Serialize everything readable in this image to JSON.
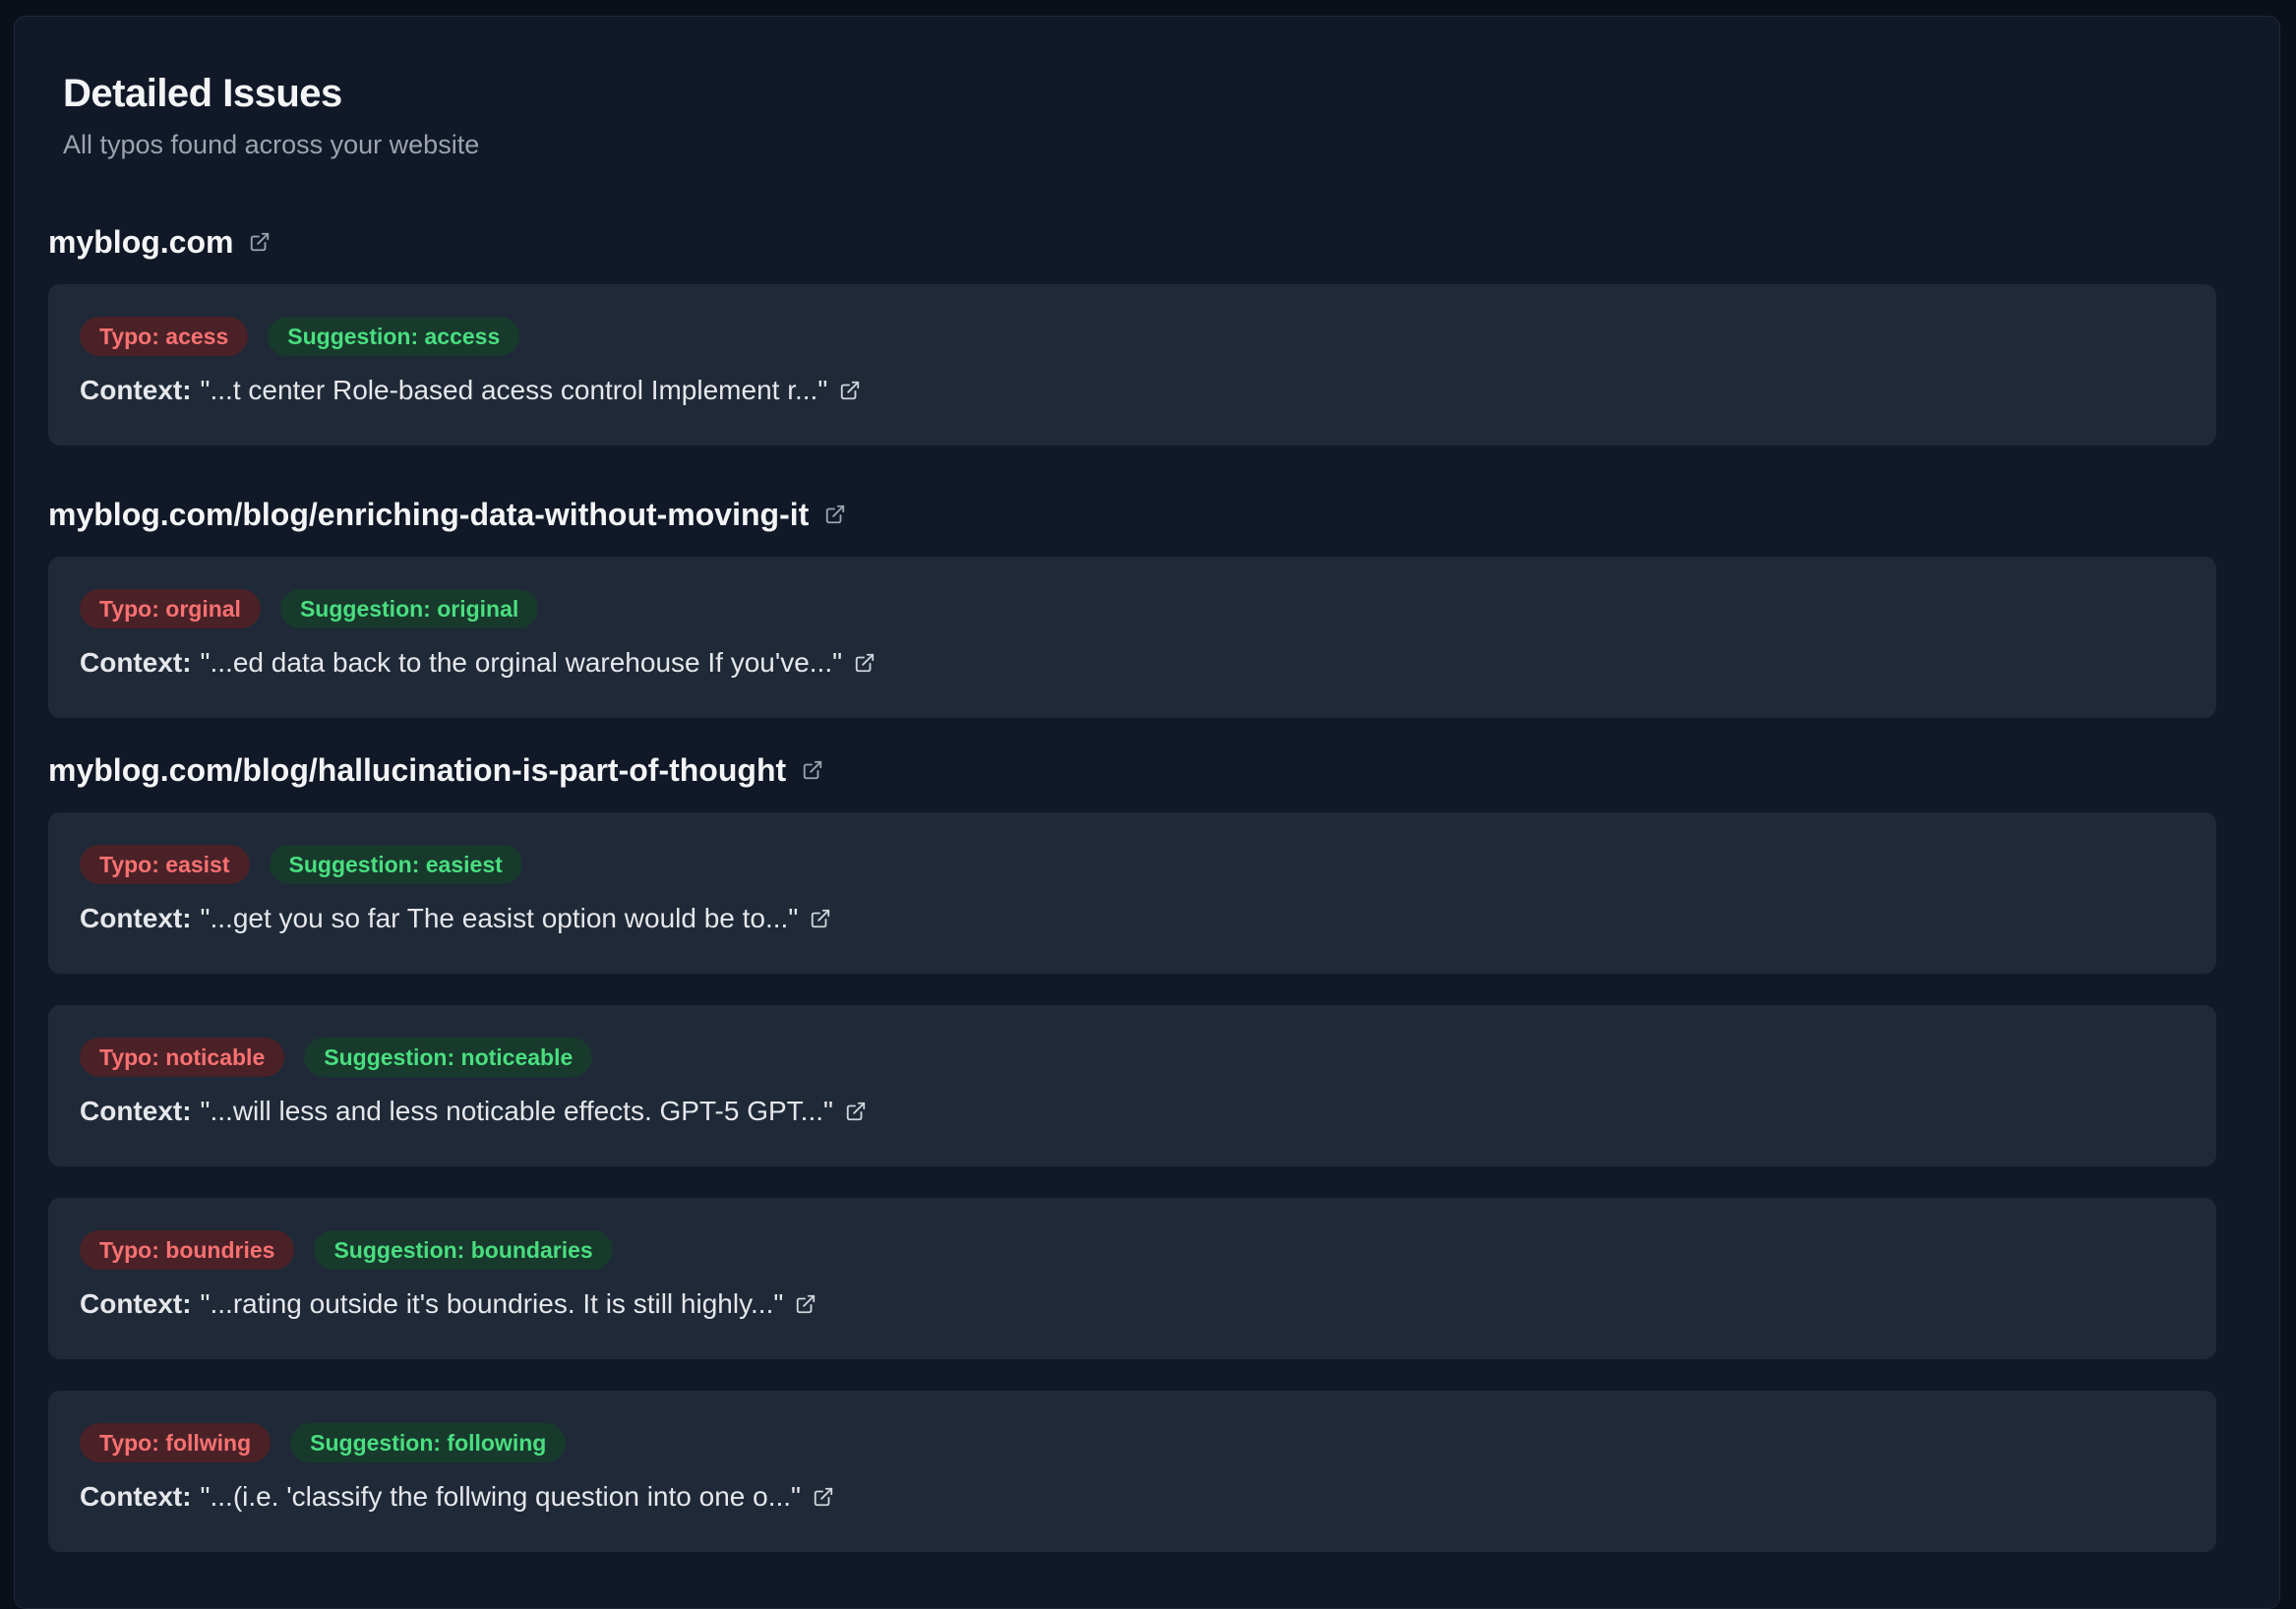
{
  "header": {
    "title": "Detailed Issues",
    "subtitle": "All typos found across your website"
  },
  "groups": [
    {
      "url": "myblog.com",
      "issues": [
        {
          "typo": "Typo: acess",
          "suggestion": "Suggestion: access",
          "context_label": "Context:",
          "context": "\"...t center Role-based acess control Implement r...\""
        }
      ]
    },
    {
      "url": "myblog.com/blog/enriching-data-without-moving-it",
      "issues": [
        {
          "typo": "Typo: orginal",
          "suggestion": "Suggestion: original",
          "context_label": "Context:",
          "context": "\"...ed data back to the orginal warehouse If you've...\""
        }
      ]
    },
    {
      "url": "myblog.com/blog/hallucination-is-part-of-thought",
      "issues": [
        {
          "typo": "Typo: easist",
          "suggestion": "Suggestion: easiest",
          "context_label": "Context:",
          "context": "\"...get you so far The easist option would be to...\""
        },
        {
          "typo": "Typo: noticable",
          "suggestion": "Suggestion: noticeable",
          "context_label": "Context:",
          "context": "\"...will less and less noticable effects. GPT-5 GPT...\""
        },
        {
          "typo": "Typo: boundries",
          "suggestion": "Suggestion: boundaries",
          "context_label": "Context:",
          "context": "\"...rating outside it's boundries. It is still highly...\""
        },
        {
          "typo": "Typo: follwing",
          "suggestion": "Suggestion: following",
          "context_label": "Context:",
          "context": "\"...(i.e. 'classify the follwing question into one o...\""
        }
      ]
    }
  ],
  "icons": {
    "external_link": "external-link-icon"
  },
  "colors": {
    "background": "#0a0f1a",
    "panel": "#111827",
    "card": "#1f2937",
    "typo_text": "#f87171",
    "typo_bg": "#4a2127",
    "suggestion_text": "#4ade80",
    "suggestion_bg": "#173a2c"
  }
}
